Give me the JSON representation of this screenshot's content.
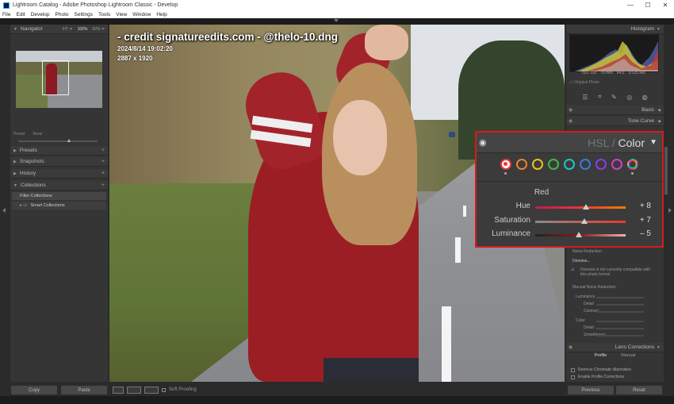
{
  "window": {
    "title": "Lightroom Catalog - Adobe Photoshop Lightroom Classic - Develop",
    "controls": [
      "—",
      "☐",
      "✕"
    ]
  },
  "menu": [
    "File",
    "Edit",
    "Develop",
    "Photo",
    "Settings",
    "Tools",
    "View",
    "Window",
    "Help"
  ],
  "left_panel": {
    "navigator": {
      "title": "Navigator",
      "opts": [
        "FIT ≑",
        "100%",
        "50% ≑"
      ]
    },
    "preset_slider": {
      "labels": [
        "Preset",
        "None"
      ],
      "amount_label": "Amount",
      "amount_value": "100"
    },
    "sections": [
      {
        "label": "Presets"
      },
      {
        "label": "Snapshots"
      },
      {
        "label": "History"
      },
      {
        "label": "Collections"
      }
    ],
    "collections": [
      "Filter Collections",
      "Smart Collections"
    ],
    "buttons": {
      "copy": "Copy",
      "paste": "Paste"
    }
  },
  "photo_overlay": {
    "credit": "- credit  signatureedits.com - @thelo-10.dng",
    "datetime": "2024/8/14 19:02:20",
    "dimensions": "2887 x 1920"
  },
  "right_panel": {
    "histogram_title": "Histogram",
    "hist_values": [
      "ISO 100",
      "70 mm",
      "f/4.0",
      "1/125 sec"
    ],
    "original_photo": "Original Photo",
    "sections": {
      "basic": "Basic",
      "tone_curve": "Tone Curve",
      "lens_corrections": "Lens Corrections"
    },
    "noise": {
      "title": "Noise Reduction",
      "denoise": "Denoise...",
      "warning": "Denoise is not currently compatible with this photo format",
      "manual": "Manual Noise Reduction",
      "rows": [
        "Luminance",
        "Detail",
        "Contrast",
        "Color",
        "Detail",
        "Smoothness"
      ]
    },
    "profile_tabs": [
      "Profile",
      "Manual"
    ],
    "checks": [
      "Remove Chromatic Aberration",
      "Enable Profile Corrections"
    ],
    "buttons": {
      "previous": "Previous",
      "reset": "Reset"
    }
  },
  "hsl": {
    "title_hsl": "HSL",
    "title_sep": " / ",
    "title_color": "Color",
    "selected_color": "Red",
    "swatch_colors": [
      "#e53935",
      "#f0812d",
      "#e8c31f",
      "#3dbb45",
      "#23c3c8",
      "#2f7de1",
      "#8a3fe0",
      "#d43bd0",
      "#e53935"
    ],
    "rows": [
      {
        "label": "Hue",
        "value": "+ 8",
        "pos": 0.56,
        "gradient": "linear-gradient(90deg,#c2185b,#e53935,#f57c00)"
      },
      {
        "label": "Saturation",
        "value": "+ 7",
        "pos": 0.54,
        "gradient": "linear-gradient(90deg,#8a8a8a,#e53935)"
      },
      {
        "label": "Luminance",
        "value": "– 5",
        "pos": 0.48,
        "gradient": "linear-gradient(90deg,#222,#8a1c1c,#f0b0b0)"
      }
    ]
  },
  "bottom_bar": {
    "soft_proofing": "Soft Proofing"
  }
}
